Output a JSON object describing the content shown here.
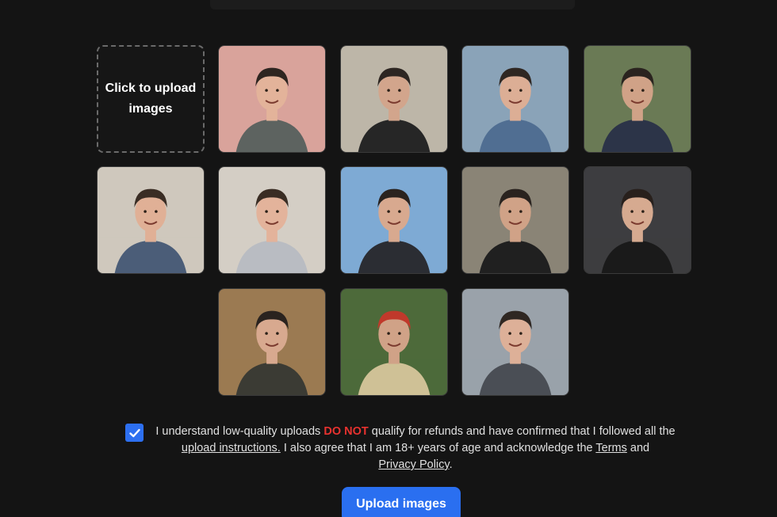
{
  "upload_tile": {
    "label": "Click to upload images"
  },
  "photos": [
    {
      "name": "photo-1",
      "scene": "pink-wall-portrait",
      "colors": {
        "bg": "#d9a39b",
        "shirt": "#5d6360",
        "skin": "#e3b39a",
        "hair": "#2e2520"
      }
    },
    {
      "name": "photo-2",
      "scene": "indoor-selfie-close",
      "colors": {
        "bg": "#bdb6a8",
        "shirt": "#262626",
        "skin": "#d2a58c",
        "hair": "#2d2622"
      }
    },
    {
      "name": "photo-3",
      "scene": "outdoor-overlook",
      "colors": {
        "bg": "#8aa3b8",
        "shirt": "#506e92",
        "skin": "#dcae95",
        "hair": "#2f2722"
      }
    },
    {
      "name": "photo-4",
      "scene": "street-plants",
      "colors": {
        "bg": "#6a7a55",
        "shirt": "#2c3448",
        "skin": "#d0a287",
        "hair": "#2a231f"
      }
    },
    {
      "name": "photo-5",
      "scene": "home-selfie-blue-shirt",
      "colors": {
        "bg": "#cfc8bd",
        "shirt": "#4b5d78",
        "skin": "#e0b096",
        "hair": "#3a2d24"
      }
    },
    {
      "name": "photo-6",
      "scene": "home-selfie-grey-shirt",
      "colors": {
        "bg": "#d4cec5",
        "shirt": "#b9bcc2",
        "skin": "#e3b39b",
        "hair": "#3a2d24"
      }
    },
    {
      "name": "photo-7",
      "scene": "city-tower-selfie",
      "colors": {
        "bg": "#7eaad4",
        "shirt": "#2b2d33",
        "skin": "#d8a98f",
        "hair": "#2a231f"
      }
    },
    {
      "name": "photo-8",
      "scene": "parking-car",
      "colors": {
        "bg": "#8a8476",
        "shirt": "#202020",
        "skin": "#d0a287",
        "hair": "#2a231f"
      }
    },
    {
      "name": "photo-9",
      "scene": "studio-dark",
      "colors": {
        "bg": "#3d3d40",
        "shirt": "#1a1a1a",
        "skin": "#d6aa90",
        "hair": "#28201c"
      }
    },
    {
      "name": "photo-10",
      "scene": "restaurant-table",
      "colors": {
        "bg": "#9b7a52",
        "shirt": "#3b3b34",
        "skin": "#d8a98f",
        "hair": "#2a231f"
      }
    },
    {
      "name": "photo-11",
      "scene": "jungle-helmet",
      "colors": {
        "bg": "#4d6a3a",
        "shirt": "#cfc196",
        "skin": "#d0a287",
        "hair": "#c0392b"
      }
    },
    {
      "name": "photo-12",
      "scene": "street-selfie-jacket",
      "colors": {
        "bg": "#9aa2aa",
        "shirt": "#4a4e55",
        "skin": "#ddb098",
        "hair": "#2f2722"
      }
    }
  ],
  "consent": {
    "checked": true,
    "text_1": "I understand low-quality uploads ",
    "do_not": "DO NOT",
    "text_2": " qualify for refunds and have confirmed that I followed all the ",
    "upload_instructions": "upload instructions.",
    "text_3": " I also agree that I am 18+ years of age and acknowledge the ",
    "terms": "Terms",
    "and": " and ",
    "privacy_policy": "Privacy Policy",
    "period": "."
  },
  "upload_button": {
    "label": "Upload images",
    "color": "#2a6ff0"
  }
}
